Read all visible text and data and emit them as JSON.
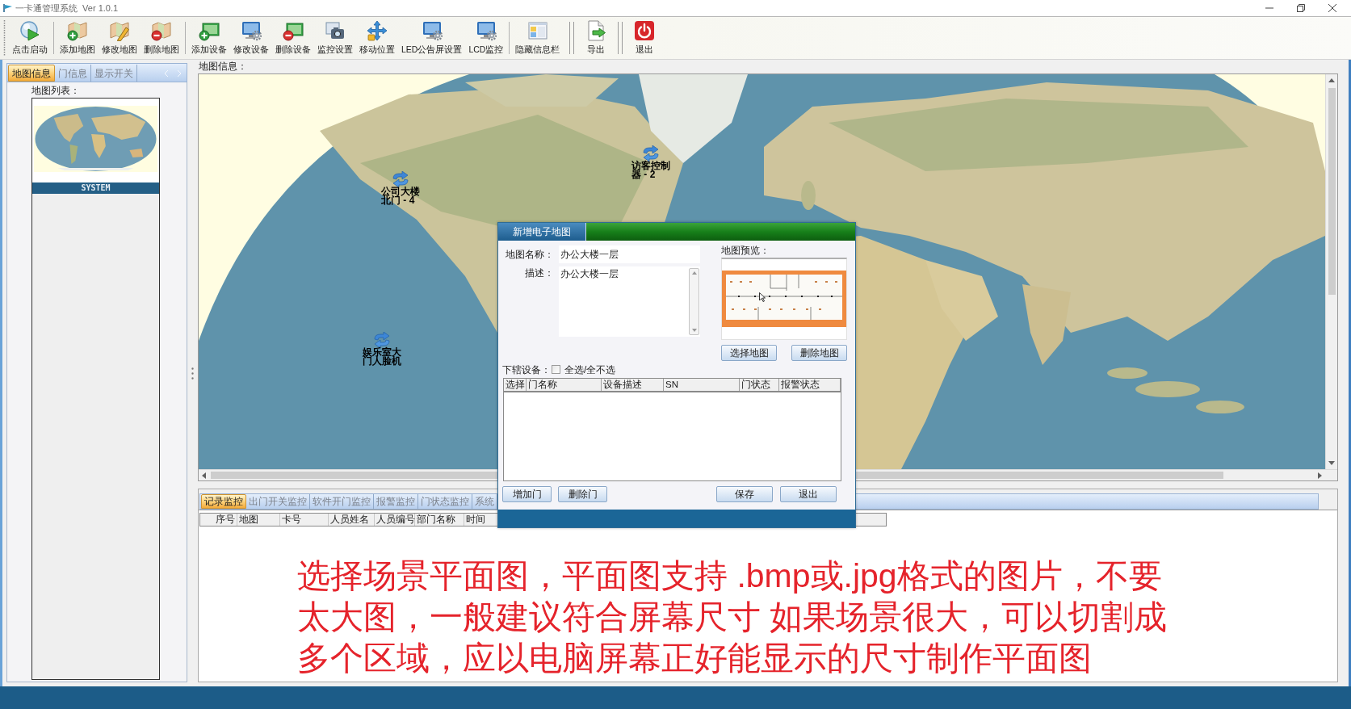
{
  "window": {
    "title": "一卡通管理系统  Ver 1.0.1"
  },
  "toolbar": {
    "groups": [
      [
        {
          "label": "点击启动"
        }
      ],
      [
        {
          "label": "添加地图"
        },
        {
          "label": "修改地图"
        },
        {
          "label": "删除地图"
        }
      ],
      [
        {
          "label": "添加设备"
        },
        {
          "label": "修改设备"
        },
        {
          "label": "删除设备"
        },
        {
          "label": "监控设置"
        },
        {
          "label": "移动位置"
        },
        {
          "label": "LED公告屏设置"
        },
        {
          "label": "LCD监控"
        }
      ],
      [
        {
          "label": "隐藏信息栏"
        }
      ],
      [
        {
          "label": "导出"
        }
      ],
      [
        {
          "label": "退出"
        }
      ]
    ]
  },
  "left_panel": {
    "tabs": [
      {
        "label": "地图信息",
        "selected": true
      },
      {
        "label": "门信息",
        "selected": false
      },
      {
        "label": "显示开关",
        "selected": false
      }
    ],
    "list_label": "地图列表：",
    "maps": [
      {
        "name": "SYSTEM",
        "selected": true
      }
    ]
  },
  "map_view": {
    "label": "地图信息：",
    "devices": [
      {
        "name": "公司大楼北门 - 4"
      },
      {
        "name": "访客控制器 - 2"
      },
      {
        "name": "娱乐室大门人脸机"
      }
    ]
  },
  "bottom_panel": {
    "tabs": [
      {
        "label": "记录监控",
        "selected": true
      },
      {
        "label": "出门开关监控",
        "selected": false
      },
      {
        "label": "软件开门监控",
        "selected": false
      },
      {
        "label": "报警监控",
        "selected": false
      },
      {
        "label": "门状态监控",
        "selected": false
      },
      {
        "label": "系统",
        "selected": false
      }
    ],
    "table": {
      "columns": [
        "序号",
        "地图",
        "卡号",
        "人员姓名",
        "人员编号",
        "部门名称",
        "时间"
      ]
    }
  },
  "dialog": {
    "title": "新增电子地图",
    "fields": [
      {
        "kind": "input",
        "label": "地图名称：",
        "value": "办公大楼一层"
      },
      {
        "kind": "textarea",
        "label": "描述：",
        "value": "办公大楼一层"
      }
    ],
    "preview_label": "地图预览：",
    "preview_buttons": [
      "选择地图",
      "删除地图"
    ],
    "devices_label": "下辖设备：",
    "select_all": {
      "label": "全选/全不选",
      "checked": false
    },
    "table": {
      "columns": [
        "选择",
        "门名称",
        "设备描述",
        "SN",
        "门状态",
        "报警状态"
      ]
    },
    "buttons_left": [
      "增加门",
      "删除门"
    ],
    "buttons_right": [
      "保存",
      "退出"
    ]
  },
  "caption": {
    "lines": [
      "选择场景平面图，平面图支持 .bmp或.jpg格式的图片，不要",
      "太大图，一般建议符合屏幕尺寸 如果场景很大，可以切割成",
      "多个区域，应以电脑屏幕正好能显示的尺寸制作平面图"
    ]
  }
}
